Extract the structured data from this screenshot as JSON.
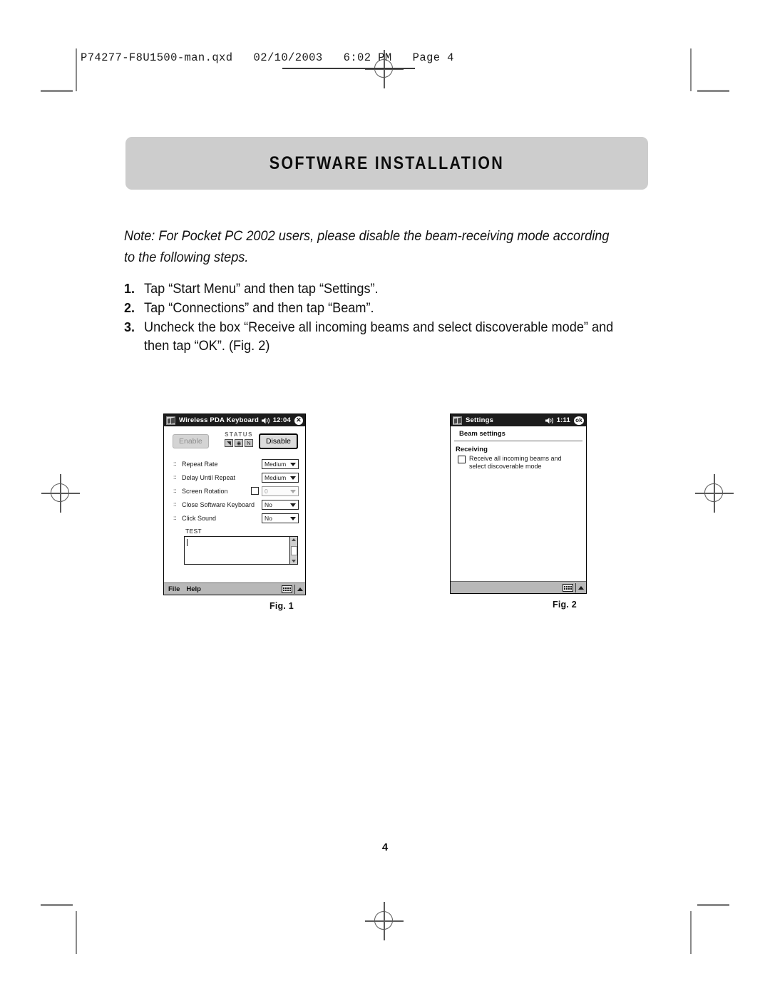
{
  "running_header": {
    "text": "P74277-F8U1500-man.qxd   02/10/2003   6:02 PM   Page 4"
  },
  "banner": {
    "title": "SOFTWARE INSTALLATION"
  },
  "note": {
    "text": "Note: For Pocket PC 2002 users, please disable the beam-receiving mode according to the following steps."
  },
  "steps": [
    {
      "num": "1.",
      "text": "Tap “Start Menu” and then tap “Settings”."
    },
    {
      "num": "2.",
      "text": "Tap “Connections” and then tap “Beam”."
    },
    {
      "num": "3.",
      "text": "Uncheck the box “Receive all incoming beams and select discoverable mode” and then tap “OK”. (Fig. 2)"
    }
  ],
  "figure1": {
    "caption": "Fig. 1",
    "titlebar": {
      "logo": "windows-logo-icon",
      "title": "Wireless PDA Keyboard",
      "speaker_icon": "speaker-icon",
      "time": "12:04",
      "close_label": "✕"
    },
    "buttons": {
      "enable": "Enable",
      "disable": "Disable"
    },
    "status": {
      "label": "STATUS",
      "boxes": [
        "◥",
        "◉",
        "N"
      ]
    },
    "settings": [
      {
        "dots": ":::",
        "label": "Repeat Rate",
        "value": "Medium",
        "checkbox": false,
        "dim": false
      },
      {
        "dots": ":::",
        "label": "Delay Until Repeat",
        "value": "Medium",
        "checkbox": false,
        "dim": false
      },
      {
        "dots": ":::",
        "label": "Screen Rotation",
        "value": "0",
        "checkbox": true,
        "dim": true
      },
      {
        "dots": ":::",
        "label": "Close Software Keyboard",
        "value": "No",
        "checkbox": false,
        "dim": false
      },
      {
        "dots": ":::",
        "label": "Click Sound",
        "value": "No",
        "checkbox": false,
        "dim": false
      }
    ],
    "test": {
      "label": "TEST",
      "value": ""
    },
    "bottombar": {
      "menu_file": "File",
      "menu_help": "Help",
      "keyboard_icon": "keyboard-icon",
      "up_arrow_icon": "chevron-up-icon"
    }
  },
  "figure2": {
    "caption": "Fig. 2",
    "titlebar": {
      "logo": "windows-logo-icon",
      "title": "Settings",
      "speaker_icon": "speaker-icon",
      "time": "1:11",
      "ok_label": "ok"
    },
    "section_title": "Beam settings",
    "sub_head": "Receiving",
    "checkbox": {
      "checked": false,
      "label_line1": "Receive all incoming beams and",
      "label_line2": "select discoverable mode"
    },
    "bottombar": {
      "keyboard_icon": "keyboard-icon",
      "up_arrow_icon": "chevron-up-icon"
    }
  },
  "page_number": "4",
  "colors": {
    "banner_bg": "#cdcdcd",
    "titlebar_bg": "#1c1c1c",
    "bottombar_bg": "#b8b8b8",
    "cropmark": "#8a8a8a"
  }
}
